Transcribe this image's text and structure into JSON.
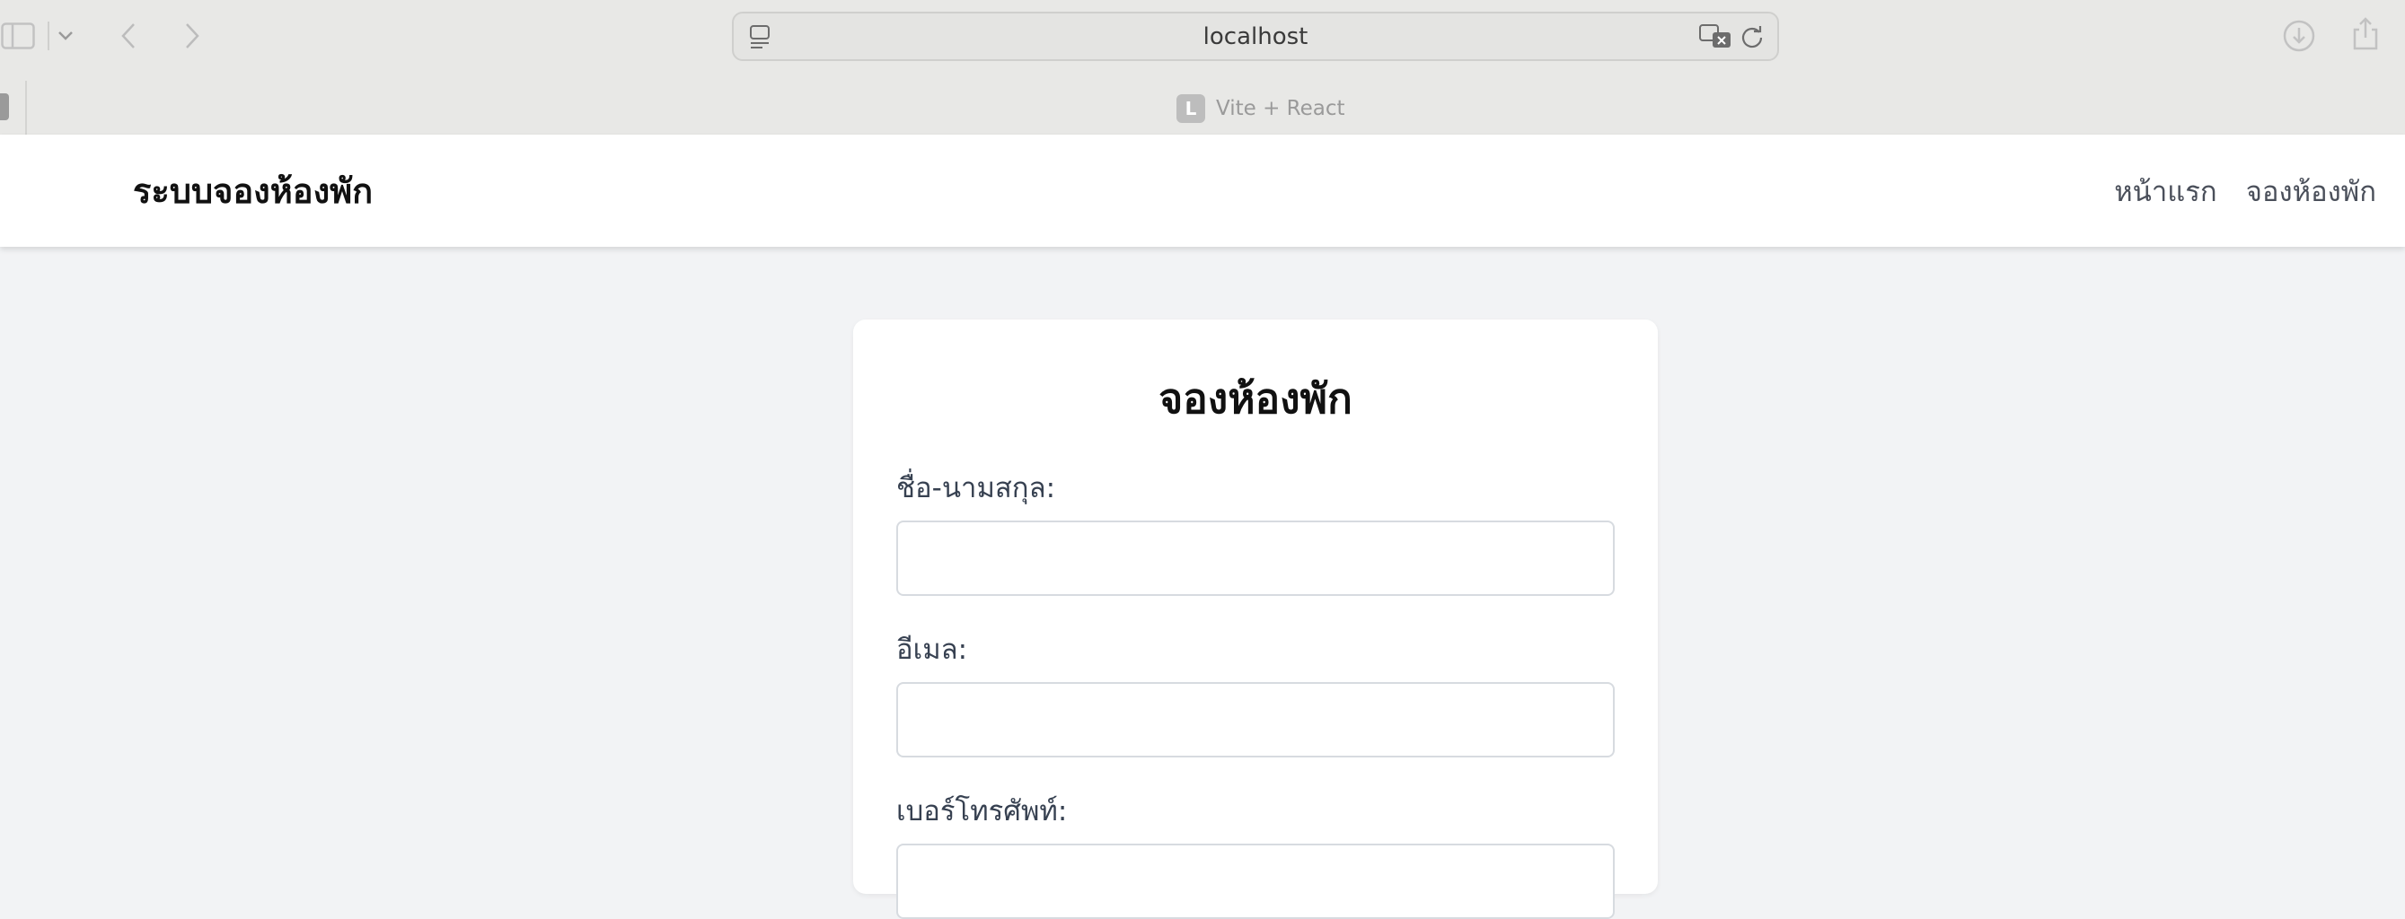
{
  "browser": {
    "url": "localhost",
    "tab": {
      "favicon_letter": "L",
      "title": "Vite + React"
    }
  },
  "icons": {
    "sidebar": "sidebar-icon",
    "tab_overview": "chevron-down-icon",
    "back": "chevron-left-icon",
    "forward": "chevron-right-icon",
    "page": "page-icon",
    "translate": "translate-icon",
    "reload": "reload-icon",
    "download": "download-icon",
    "share": "share-icon"
  },
  "colors": {
    "chrome_bg": "#e8e8e6",
    "page_bg": "#f2f3f5",
    "navbar_bg": "#ffffff",
    "text_dark": "#111111",
    "text_label": "#374151",
    "input_border": "#d7dbe0"
  },
  "navbar": {
    "brand": "ระบบจองห้องพัก",
    "links": [
      "หน้าแรก",
      "จองห้องพัก"
    ]
  },
  "form": {
    "title": "จองห้องพัก",
    "fields": [
      {
        "label": "ชื่อ-นามสกุล:",
        "value": ""
      },
      {
        "label": "อีเมล:",
        "value": ""
      },
      {
        "label": "เบอร์โทรศัพท์:",
        "value": ""
      }
    ]
  }
}
